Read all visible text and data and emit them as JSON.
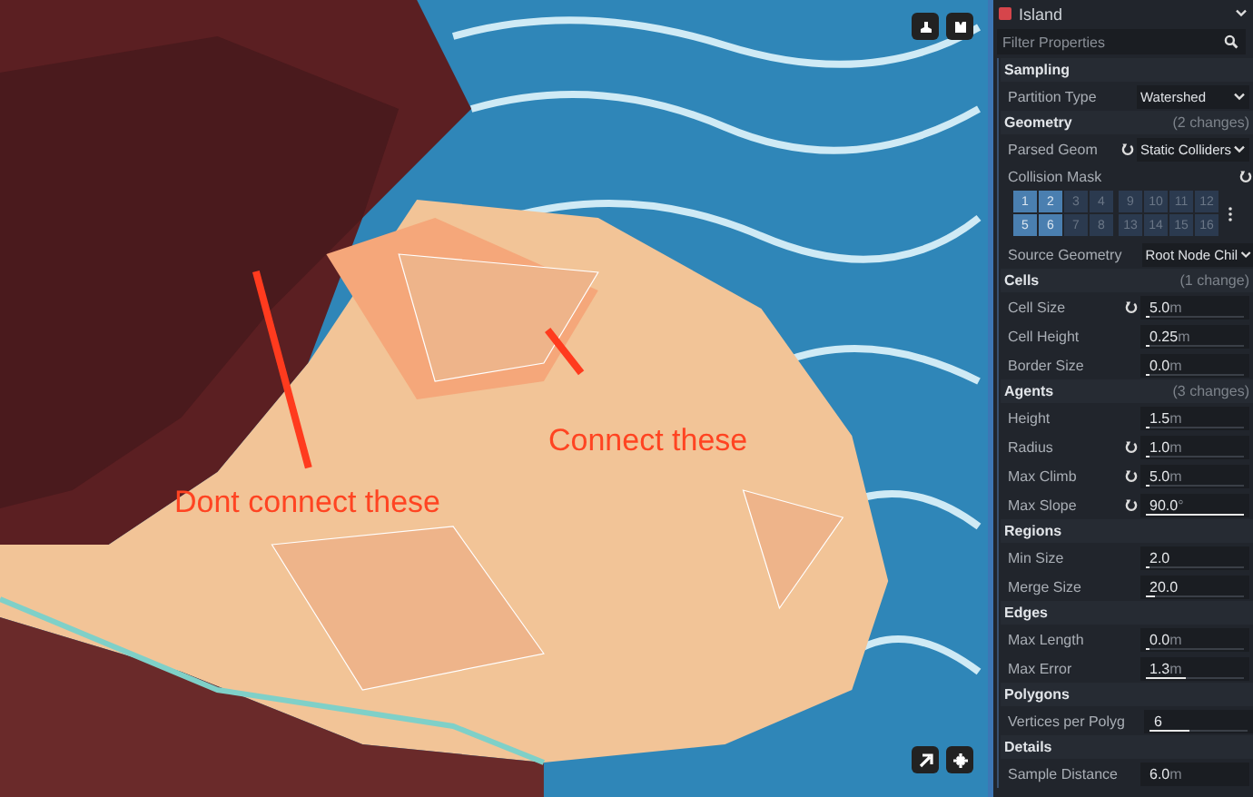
{
  "viewport": {
    "annotations": [
      {
        "text": "Dont connect these",
        "kind": "long"
      },
      {
        "text": "Connect these",
        "kind": "short"
      }
    ]
  },
  "inspector": {
    "object": {
      "name": "Island"
    },
    "filter": {
      "placeholder": "Filter Properties"
    },
    "sections": [
      {
        "title": "Sampling",
        "properties": [
          {
            "kind": "dropdown",
            "label": "Partition Type",
            "revert": false,
            "value": "Watershed"
          }
        ]
      },
      {
        "title": "Geometry",
        "changes": "(2 changes)",
        "properties": [
          {
            "kind": "dropdown",
            "label": "Parsed Geom",
            "revert": true,
            "value": "Static Colliders"
          },
          {
            "kind": "mask",
            "label": "Collision Mask",
            "revert": true,
            "rows": [
              [
                {
                  "label": "1",
                  "selected": true
                },
                {
                  "label": "2",
                  "selected": true
                },
                {
                  "label": "3",
                  "selected": false
                },
                {
                  "label": "4",
                  "selected": false
                },
                {
                  "label": "9",
                  "selected": false
                },
                {
                  "label": "10",
                  "selected": false
                },
                {
                  "label": "11",
                  "selected": false
                },
                {
                  "label": "12",
                  "selected": false
                }
              ],
              [
                {
                  "label": "5",
                  "selected": true
                },
                {
                  "label": "6",
                  "selected": true
                },
                {
                  "label": "7",
                  "selected": false
                },
                {
                  "label": "8",
                  "selected": false
                },
                {
                  "label": "13",
                  "selected": false
                },
                {
                  "label": "14",
                  "selected": false
                },
                {
                  "label": "15",
                  "selected": false
                },
                {
                  "label": "16",
                  "selected": false
                }
              ]
            ]
          },
          {
            "kind": "dropdown",
            "label": "Source Geometry",
            "revert": false,
            "value": "Root Node Chil"
          }
        ]
      },
      {
        "title": "Cells",
        "changes": "(1 change)",
        "properties": [
          {
            "kind": "slider",
            "label": "Cell Size",
            "revert": true,
            "value": "5.0",
            "unit": "m",
            "level": 0.02
          },
          {
            "kind": "slider",
            "label": "Cell Height",
            "revert": false,
            "value": "0.25",
            "unit": "m",
            "level": 0.02
          },
          {
            "kind": "slider",
            "label": "Border Size",
            "revert": false,
            "value": "0.0",
            "unit": "m",
            "level": 0.02
          }
        ]
      },
      {
        "title": "Agents",
        "changes": "(3 changes)",
        "properties": [
          {
            "kind": "slider",
            "label": "Height",
            "revert": false,
            "value": "1.5",
            "unit": "m",
            "level": 0.02
          },
          {
            "kind": "slider",
            "label": "Radius",
            "revert": true,
            "value": "1.0",
            "unit": "m",
            "level": 0.02
          },
          {
            "kind": "slider",
            "label": "Max Climb",
            "revert": true,
            "value": "5.0",
            "unit": "m",
            "level": 0.02
          },
          {
            "kind": "slider",
            "label": "Max Slope",
            "revert": true,
            "value": "90.0",
            "unit": "°",
            "level": 1.0
          }
        ]
      },
      {
        "title": "Regions",
        "properties": [
          {
            "kind": "slider",
            "label": "Min Size",
            "revert": false,
            "value": "2.0",
            "level": 0.02
          },
          {
            "kind": "slider",
            "label": "Merge Size",
            "revert": false,
            "value": "20.0",
            "level": 0.1
          }
        ]
      },
      {
        "title": "Edges",
        "properties": [
          {
            "kind": "slider",
            "label": "Max Length",
            "revert": false,
            "value": "0.0",
            "unit": "m",
            "level": 0.0
          },
          {
            "kind": "slider",
            "label": "Max Error",
            "revert": false,
            "value": "1.3",
            "unit": "m",
            "level": 0.4
          }
        ]
      },
      {
        "title": "Polygons",
        "properties": [
          {
            "kind": "slider",
            "label": "Vertices per Polyg",
            "revert": false,
            "value": "6",
            "level": 0.4
          }
        ]
      },
      {
        "title": "Details",
        "properties": [
          {
            "kind": "slider",
            "label": "Sample Distance",
            "revert": false,
            "value": "6.0",
            "unit": "m"
          }
        ]
      }
    ]
  }
}
